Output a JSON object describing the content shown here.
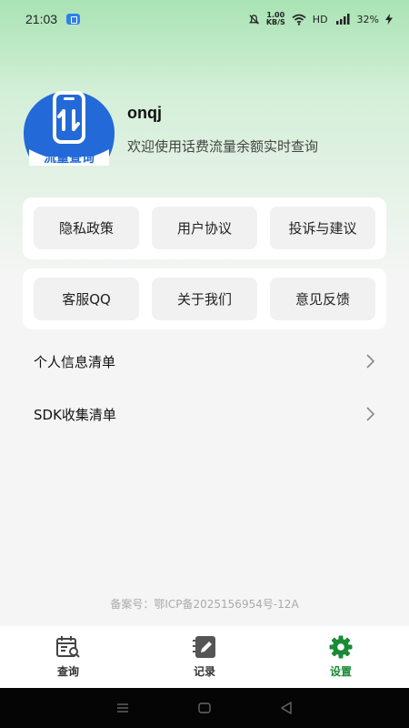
{
  "status_bar": {
    "time": "21:03",
    "speed": "1.00",
    "speed_unit": "KB/S",
    "network": "HD",
    "battery": "32%"
  },
  "profile": {
    "name": "onqj",
    "subtitle": "欢迎使用话费流量余额实时查询",
    "logo_text": "流量查询"
  },
  "menu_card_1": [
    "隐私政策",
    "用户协议",
    "投诉与建议"
  ],
  "menu_card_2": [
    "客服QQ",
    "关于我们",
    "意见反馈"
  ],
  "list": {
    "personal_info": "个人信息清单",
    "sdk_list": "SDK收集清单"
  },
  "icp": "备案号：鄂ICP备2025156954号-12A",
  "bottom_nav": {
    "items": [
      {
        "label": "查询",
        "icon": "calendar-search-icon"
      },
      {
        "label": "记录",
        "icon": "notebook-edit-icon"
      },
      {
        "label": "设置",
        "icon": "gear-icon"
      }
    ],
    "active": "设置"
  },
  "colors": {
    "accent": "#1a8a35",
    "logo_blue": "#2369d8",
    "header_green": "#a9e3b4"
  }
}
